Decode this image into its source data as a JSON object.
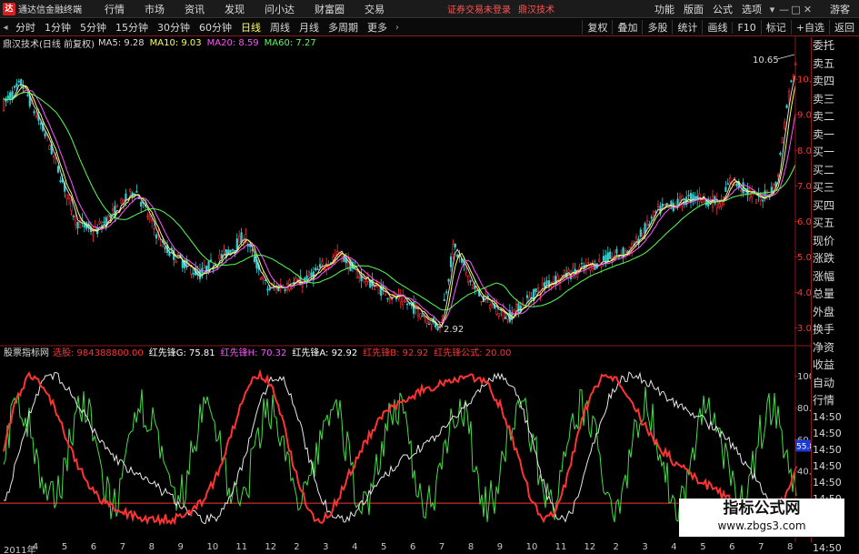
{
  "app": {
    "logo": "达",
    "title": "通达信金融终端"
  },
  "menu": [
    "行情",
    "市场",
    "资讯",
    "发现",
    "问小达",
    "财富圈",
    "交易"
  ],
  "login_status": "证券交易未登录",
  "broker": "鼎汉技术",
  "right_menu": [
    "功能",
    "版面",
    "公式",
    "选项"
  ],
  "window_controls": [
    "▾",
    "—",
    "□",
    "✕"
  ],
  "guest": "游客",
  "toolbar": {
    "left_arrow": "◂",
    "periods": [
      "分时",
      "1分钟",
      "5分钟",
      "15分钟",
      "30分钟",
      "60分钟",
      "日线",
      "周线",
      "月线",
      "多周期",
      "更多"
    ],
    "active_period": "日线",
    "more_arrow": "›",
    "right": [
      "复权",
      "叠加",
      "多股",
      "统计",
      "画线",
      "F10",
      "标记",
      "+自选",
      "返回"
    ]
  },
  "main_chart": {
    "stock_label": "鼎汉技术(日线 前复权)",
    "ma": [
      {
        "label": "MA5: 9.28",
        "color": "#dcdcdc"
      },
      {
        "label": "MA10: 9.03",
        "color": "#ffff55"
      },
      {
        "label": "MA20: 8.59",
        "color": "#ff55ff"
      },
      {
        "label": "MA60: 7.27",
        "color": "#55ff55"
      }
    ],
    "high_marker": "10.65",
    "low_marker": "2.92",
    "y_ticks": [
      "10.00",
      "9.00",
      "8.00",
      "7.00",
      "6.00",
      "5.00",
      "4.00",
      "3.00"
    ]
  },
  "indicator": {
    "name": "股票指标网",
    "values": [
      {
        "label": "选股: 984388800.00",
        "color": "#ff3333"
      },
      {
        "label": "红先锋G: 75.81",
        "color": "#ffffff"
      },
      {
        "label": "红先锋H: 70.32",
        "color": "#ff55ff"
      },
      {
        "label": "红先锋A: 92.92",
        "color": "#ffffff"
      },
      {
        "label": "红先锋B: 92.92",
        "color": "#ff3333"
      },
      {
        "label": "红先锋公式: 20.00",
        "color": "#ff3333"
      }
    ],
    "y_ticks": [
      "100.0",
      "80.00",
      "60.00",
      "40.00",
      "20.00"
    ],
    "current_value": "55.89"
  },
  "right_panel": {
    "items": [
      "委托",
      "卖五",
      "卖四",
      "卖三",
      "卖二",
      "卖一",
      "买一",
      "买二",
      "买三",
      "买四",
      "买五",
      "现价",
      "涨跌",
      "涨幅",
      "总量",
      "外盘",
      "换手",
      "净资",
      "收益"
    ],
    "label": "自动",
    "label2": "行情",
    "times": [
      "14:50",
      "14:50",
      "14:50",
      "14:50",
      "14:50",
      "14:50",
      "14:50",
      "14:50",
      "14:50"
    ]
  },
  "date_axis": [
    "2011年",
    "4",
    "5",
    "6",
    "7",
    "8",
    "9",
    "10",
    "11",
    "12",
    "2",
    "3",
    "4",
    "5",
    "6",
    "7",
    "8",
    "9",
    "10",
    "11",
    "12",
    "2",
    "3",
    "4",
    "5",
    "6",
    "7",
    "8"
  ],
  "watermark": {
    "title": "指标公式网",
    "url": "www.zbgs3.com"
  },
  "colors": {
    "up": "#ff3333",
    "down": "#55ff55",
    "border": "#8b1a1a",
    "ma60": "#55ff55"
  }
}
